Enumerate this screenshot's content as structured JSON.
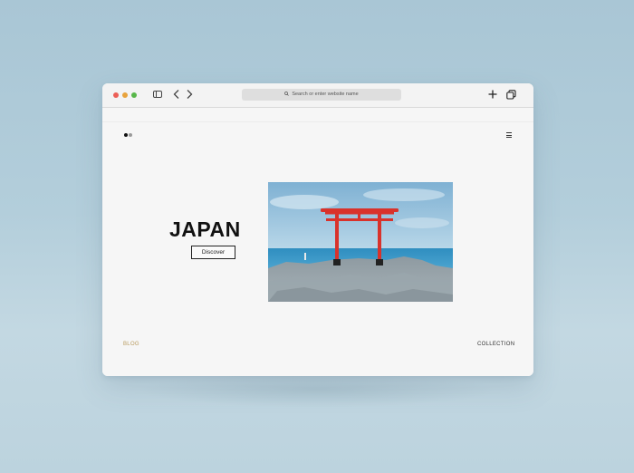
{
  "browser": {
    "url_placeholder": "Search or enter website name",
    "icons": [
      "sidebar-icon",
      "back-arrow-icon",
      "forward-arrow-icon",
      "search-icon",
      "plus-icon",
      "tabs-icon"
    ]
  },
  "site": {
    "hero_title": "JAPAN",
    "discover_label": "Discover",
    "footer_left": "BLOG",
    "footer_right": "COLLECTION",
    "hero_image": "torii-gate-on-rocky-shore"
  },
  "colors": {
    "close": "#ec5f57",
    "minimize": "#e8a33d",
    "maximize": "#58b74a",
    "torii": "#d9322b"
  }
}
